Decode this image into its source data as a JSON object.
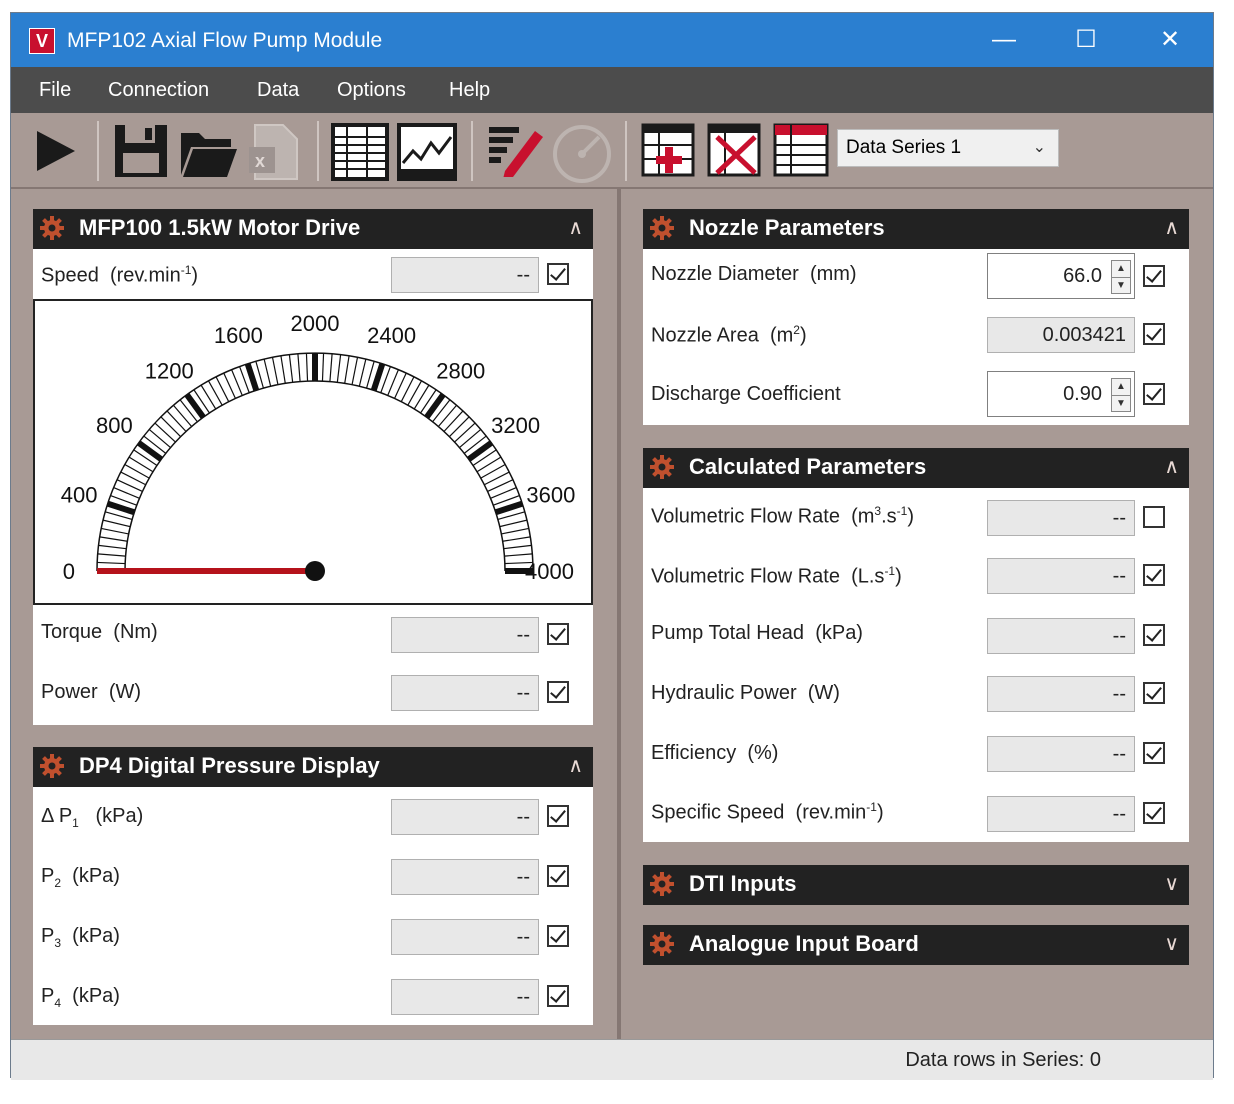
{
  "window": {
    "title": "MFP102 Axial Flow Pump Module",
    "logo_letter": "V",
    "minimize": "—",
    "maximize": "☐",
    "close": "✕"
  },
  "menu": {
    "items": [
      "File",
      "Connection",
      "Data",
      "Options",
      "Help"
    ]
  },
  "toolbar": {
    "series_select": "Data Series 1",
    "icons": [
      "play-icon",
      "save-icon",
      "open-folder-icon",
      "export-excel-icon",
      "table-view-icon",
      "chart-view-icon",
      "edit-icon",
      "gauge-icon",
      "add-row-icon",
      "delete-row-icon",
      "table-icon"
    ]
  },
  "motor_panel": {
    "title": "MFP100 1.5kW Motor Drive",
    "speed": {
      "label": "Speed",
      "unit_pre": "(rev.min",
      "unit_sup": "-1",
      "unit_post": ")",
      "value": "--",
      "checked": true
    },
    "gauge": {
      "min": 0,
      "max": 4000,
      "value": 0,
      "ticks": [
        "0",
        "400",
        "800",
        "1200",
        "1600",
        "2000",
        "2400",
        "2800",
        "3200",
        "3600",
        "4000"
      ]
    },
    "torque": {
      "label": "Torque",
      "unit": "(Nm)",
      "value": "--",
      "checked": true
    },
    "power": {
      "label": "Power",
      "unit": "(W)",
      "value": "--",
      "checked": true
    }
  },
  "dp4_panel": {
    "title": "DP4 Digital Pressure Display",
    "rows": [
      {
        "pre": "Δ P",
        "sub": "1",
        "unit": "(kPa)",
        "value": "--",
        "checked": true
      },
      {
        "pre": "P",
        "sub": "2",
        "unit": "(kPa)",
        "value": "--",
        "checked": true
      },
      {
        "pre": "P",
        "sub": "3",
        "unit": "(kPa)",
        "value": "--",
        "checked": true
      },
      {
        "pre": "P",
        "sub": "4",
        "unit": "(kPa)",
        "value": "--",
        "checked": true
      }
    ]
  },
  "nozzle_panel": {
    "title": "Nozzle Parameters",
    "diameter": {
      "label": "Nozzle Diameter",
      "unit": "(mm)",
      "value": "66.0",
      "checked": true
    },
    "area": {
      "label": "Nozzle Area",
      "unit_pre": "(m",
      "unit_sup": "2",
      "unit_post": ")",
      "value": "0.003421",
      "checked": true
    },
    "coefficient": {
      "label": "Discharge Coefficient",
      "value": "0.90",
      "checked": true
    }
  },
  "calc_panel": {
    "title": "Calculated Parameters",
    "vol_m3": {
      "label": "Volumetric Flow Rate",
      "u1": "(m",
      "s1": "3",
      "u2": ".s",
      "s2": "-1",
      "u3": ")",
      "value": "--",
      "checked": false
    },
    "vol_l": {
      "label": "Volumetric Flow Rate",
      "u1": "(L.s",
      "s1": "-1",
      "u2": ")",
      "value": "--",
      "checked": true
    },
    "head": {
      "label": "Pump Total Head",
      "unit": "(kPa)",
      "value": "--",
      "checked": true
    },
    "hydraulic": {
      "label": "Hydraulic Power",
      "unit": "(W)",
      "value": "--",
      "checked": true
    },
    "efficiency": {
      "label": "Efficiency",
      "unit": "(%)",
      "value": "--",
      "checked": true
    },
    "specific": {
      "label": "Specific Speed",
      "u1": "(rev.min",
      "s1": "-1",
      "u2": ")",
      "value": "--",
      "checked": true
    }
  },
  "dti_panel": {
    "title": "DTI Inputs"
  },
  "analogue_panel": {
    "title": "Analogue Input Board"
  },
  "status": {
    "text": "Data rows in Series: 0"
  }
}
